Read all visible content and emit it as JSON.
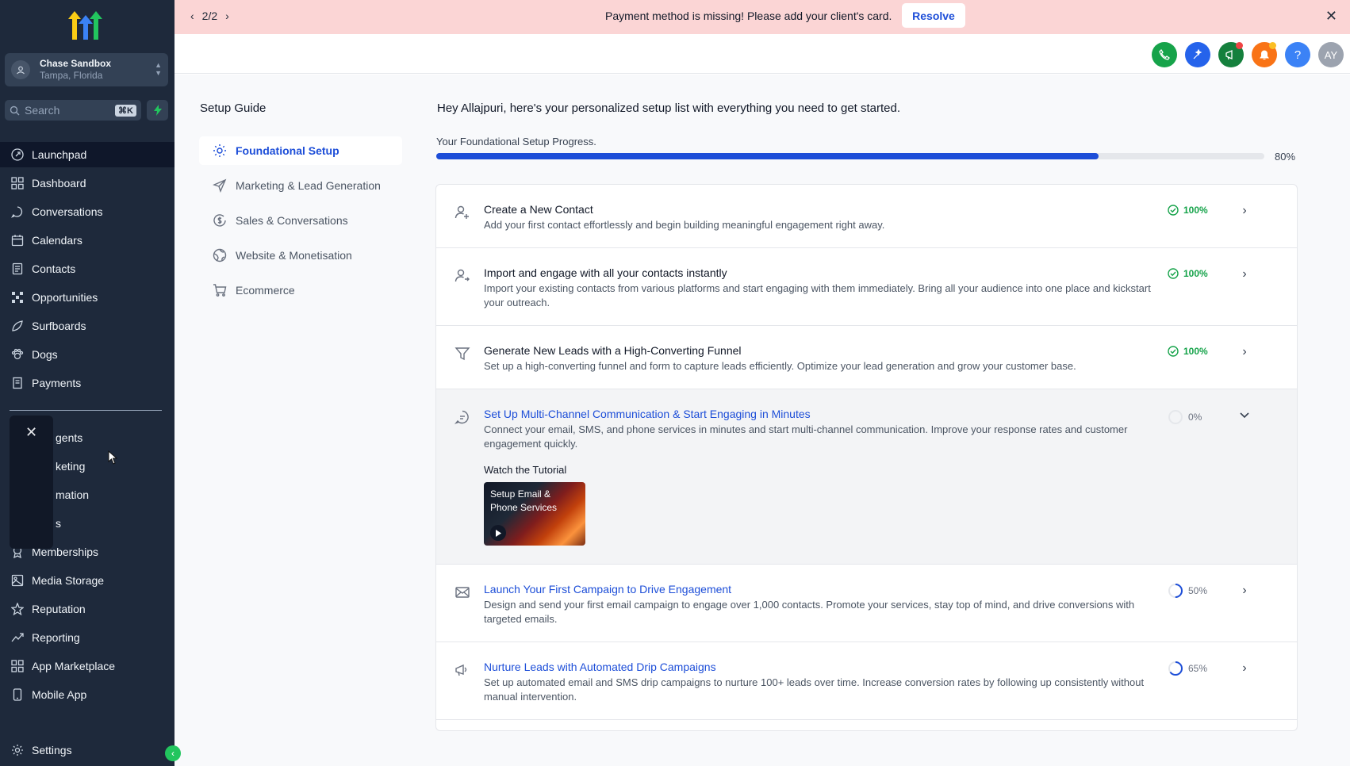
{
  "sidebar": {
    "account": {
      "name": "Chase Sandbox",
      "location": "Tampa, Florida"
    },
    "search": {
      "placeholder": "Search",
      "shortcut": "⌘K"
    },
    "items": [
      {
        "label": "Launchpad",
        "icon": "rocket-icon"
      },
      {
        "label": "Dashboard",
        "icon": "grid-icon"
      },
      {
        "label": "Conversations",
        "icon": "chat-icon"
      },
      {
        "label": "Calendars",
        "icon": "calendar-icon"
      },
      {
        "label": "Contacts",
        "icon": "contacts-icon"
      },
      {
        "label": "Opportunities",
        "icon": "opportunities-icon"
      },
      {
        "label": "Surfboards",
        "icon": "surfboard-icon"
      },
      {
        "label": "Dogs",
        "icon": "paw-icon"
      },
      {
        "label": "Payments",
        "icon": "receipt-icon"
      }
    ],
    "secondary_items": [
      {
        "label": "gents"
      },
      {
        "label": "keting"
      },
      {
        "label": "mation"
      },
      {
        "label": "s"
      },
      {
        "label": "Memberships"
      },
      {
        "label": "Media Storage"
      },
      {
        "label": "Reputation"
      },
      {
        "label": "Reporting"
      },
      {
        "label": "App Marketplace"
      },
      {
        "label": "Mobile App"
      }
    ],
    "settings_label": "Settings"
  },
  "banner": {
    "pager": "2/2",
    "message": "Payment method is missing! Please add your client's card.",
    "resolve_label": "Resolve"
  },
  "header": {
    "avatar_initials": "AY",
    "help_label": "?"
  },
  "guide": {
    "title": "Setup Guide",
    "items": [
      {
        "label": "Foundational Setup"
      },
      {
        "label": "Marketing & Lead Generation"
      },
      {
        "label": "Sales & Conversations"
      },
      {
        "label": "Website & Monetisation"
      },
      {
        "label": "Ecommerce"
      }
    ]
  },
  "main": {
    "greeting": "Hey Allajpuri, here's your personalized setup list with everything you need to get started.",
    "progress_label": "Your Foundational Setup Progress.",
    "progress_value": 0.8,
    "progress_pct_label": "80%"
  },
  "tasks": [
    {
      "title": "Create a New Contact",
      "desc": "Add your first contact effortlessly and begin building meaningful engagement right away.",
      "pct": "100%"
    },
    {
      "title": "Import and engage with all your contacts instantly",
      "desc": "Import your existing contacts from various platforms and start engaging with them immediately. Bring all your audience into one place and kickstart your outreach.",
      "pct": "100%"
    },
    {
      "title": "Generate New Leads with a High-Converting Funnel",
      "desc": "Set up a high-converting funnel and form to capture leads efficiently. Optimize your lead generation and grow your customer base.",
      "pct": "100%"
    },
    {
      "title": "Set Up Multi-Channel Communication & Start Engaging in Minutes",
      "desc": "Connect your email, SMS, and phone services in minutes and start multi-channel communication. Improve your response rates and customer engagement quickly.",
      "pct": "0%",
      "tutorial_label": "Watch the Tutorial",
      "tutorial_title": "Setup Email & Phone Services"
    },
    {
      "title": "Launch Your First Campaign to Drive Engagement",
      "desc": "Design and send your first email campaign to engage over 1,000 contacts. Promote your services, stay top of mind, and drive conversions with targeted emails.",
      "pct": "50%"
    },
    {
      "title": "Nurture Leads with Automated Drip Campaigns",
      "desc": "Set up automated email and SMS drip campaigns to nurture 100+ leads over time. Increase conversion rates by following up consistently without manual intervention.",
      "pct": "65%"
    }
  ],
  "colors": {
    "sidebar_bg": "#1e293b",
    "accent": "#1d4ed8",
    "success": "#16a34a",
    "banner_bg": "#fbd5d5"
  }
}
